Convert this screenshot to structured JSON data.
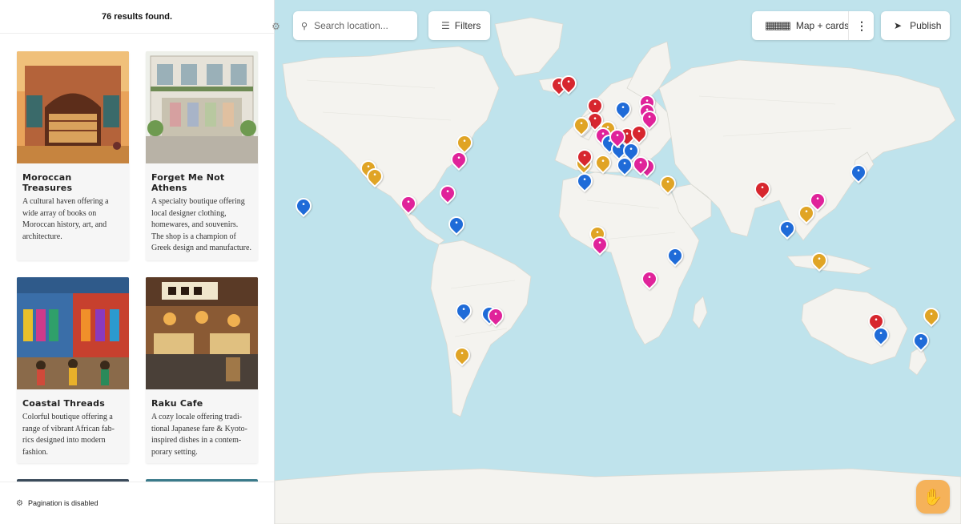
{
  "sidebar": {
    "results_label": "76 results found.",
    "footer_label": "Pagination is disabled",
    "cards": [
      {
        "title": "Moroccan Treasures",
        "description": "A cultural haven offering a wide array of books on Moroccan history, art, and architecture."
      },
      {
        "title": "Forget Me Not Athens",
        "description": "A specialty boutique offering local designer clothing, homewares, and souvenirs. The shop is a champion of Greek design and manufacture."
      },
      {
        "title": "Coastal Threads",
        "description": "Colorful boutique offering a range of vibrant African fab­rics designed into modern fashion."
      },
      {
        "title": "Raku Cafe",
        "description": "A cozy locale offering tradi­tional Japanese fare & Kyoto-inspired dishes in a contem­porary setting."
      }
    ]
  },
  "toolbar": {
    "search_placeholder": "Search location...",
    "filters_label": "Filters",
    "view_mode_label": "Map + cards",
    "more_label": "⋮",
    "publish_label": "Publish"
  },
  "icons": {
    "search": "search-icon",
    "filters": "sliders-icon",
    "view_mode": "map-cards-icon",
    "more": "more-vertical-icon",
    "publish": "rocket-icon",
    "settings": "gear-icon",
    "help": "wave-hand-icon"
  },
  "colors": {
    "pin_red": "#d7262e",
    "pin_blue": "#1f6bd8",
    "pin_pink": "#e0239a",
    "pin_gold": "#e0a425",
    "water": "#bfe3ec",
    "land": "#f4f3ef",
    "help_button": "#f5b25a"
  }
}
